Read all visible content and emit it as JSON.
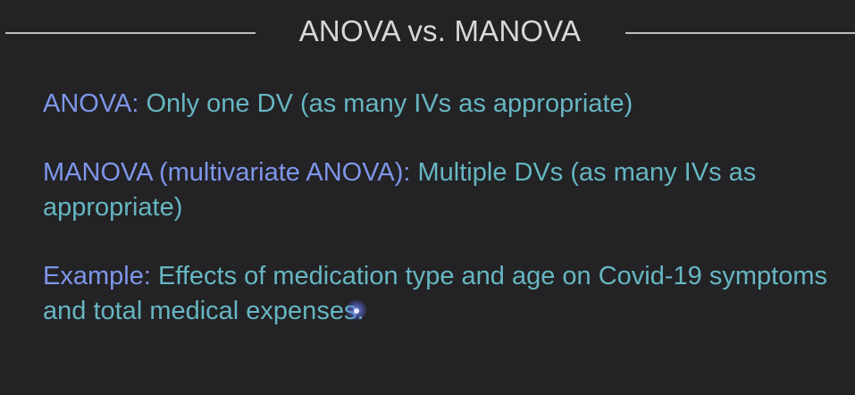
{
  "slide": {
    "title": "ANOVA vs. MANOVA",
    "items": [
      {
        "term": "ANOVA:",
        "text": " Only one DV (as many IVs as appropriate)"
      },
      {
        "term": "MANOVA (multivariate ANOVA):",
        "text": " Multiple DVs (as many IVs as appropriate)"
      },
      {
        "term": "Example:",
        "text": " Effects of medication type and age on Covid-19 symptoms and total medical expenses."
      }
    ]
  },
  "colors": {
    "background": "#232224",
    "title": "#d8d8d8",
    "term": "#7e96ea",
    "body": "#66b6c2",
    "rule": "#bdbdbd"
  },
  "icons": {
    "cursor": "mouse-pointer-highlight"
  }
}
